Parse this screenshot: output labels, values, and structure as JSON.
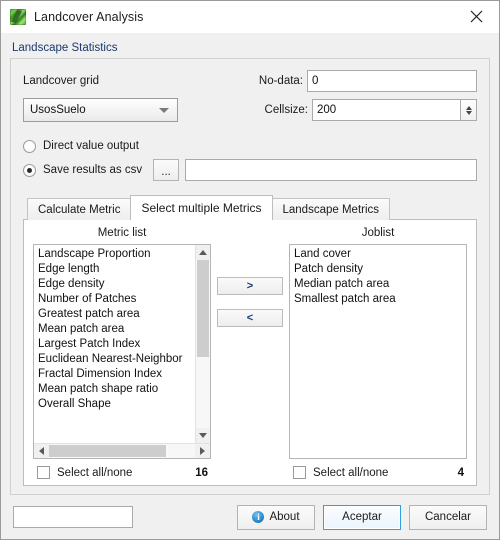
{
  "window": {
    "title": "Landcover Analysis",
    "icon": "landcover-map-icon",
    "close_label": "close-icon"
  },
  "group": {
    "label": "Landscape Statistics"
  },
  "grid_section": {
    "grid_label": "Landcover grid",
    "grid_value": "UsosSuelo",
    "nodata_label": "No-data:",
    "nodata_value": "0",
    "cellsize_label": "Cellsize:",
    "cellsize_value": "200"
  },
  "output": {
    "direct_label": "Direct value output",
    "direct_selected": false,
    "csv_label": "Save results as csv",
    "csv_selected": true,
    "browse_label": "...",
    "csv_path_value": "",
    "csv_path_placeholder": ""
  },
  "tabs": [
    {
      "label": "Calculate Metric",
      "active": false
    },
    {
      "label": "Select multiple Metrics",
      "active": true
    },
    {
      "label": "Landscape Metrics",
      "active": false
    }
  ],
  "lists": {
    "metric_header": "Metric list",
    "joblist_header": "Joblist",
    "metric_items": [
      "Landscape Proportion",
      "Edge length",
      "Edge density",
      "Number of Patches",
      "Greatest patch area",
      "Mean patch area",
      "Largest Patch Index",
      "Euclidean Nearest-Neighbor",
      "Fractal Dimension Index",
      "Mean patch shape ratio",
      "Overall Shape"
    ],
    "job_items": [
      "Land cover",
      "Patch density",
      "Median patch area",
      "Smallest patch area"
    ],
    "add_button": ">",
    "remove_button": "<",
    "metric_select_all_label": "Select all/none",
    "metric_count": "16",
    "job_select_all_label": "Select all/none",
    "job_count": "4"
  },
  "footer": {
    "status_value": "",
    "about_label": "About",
    "accept_label": "Aceptar",
    "cancel_label": "Cancelar"
  }
}
